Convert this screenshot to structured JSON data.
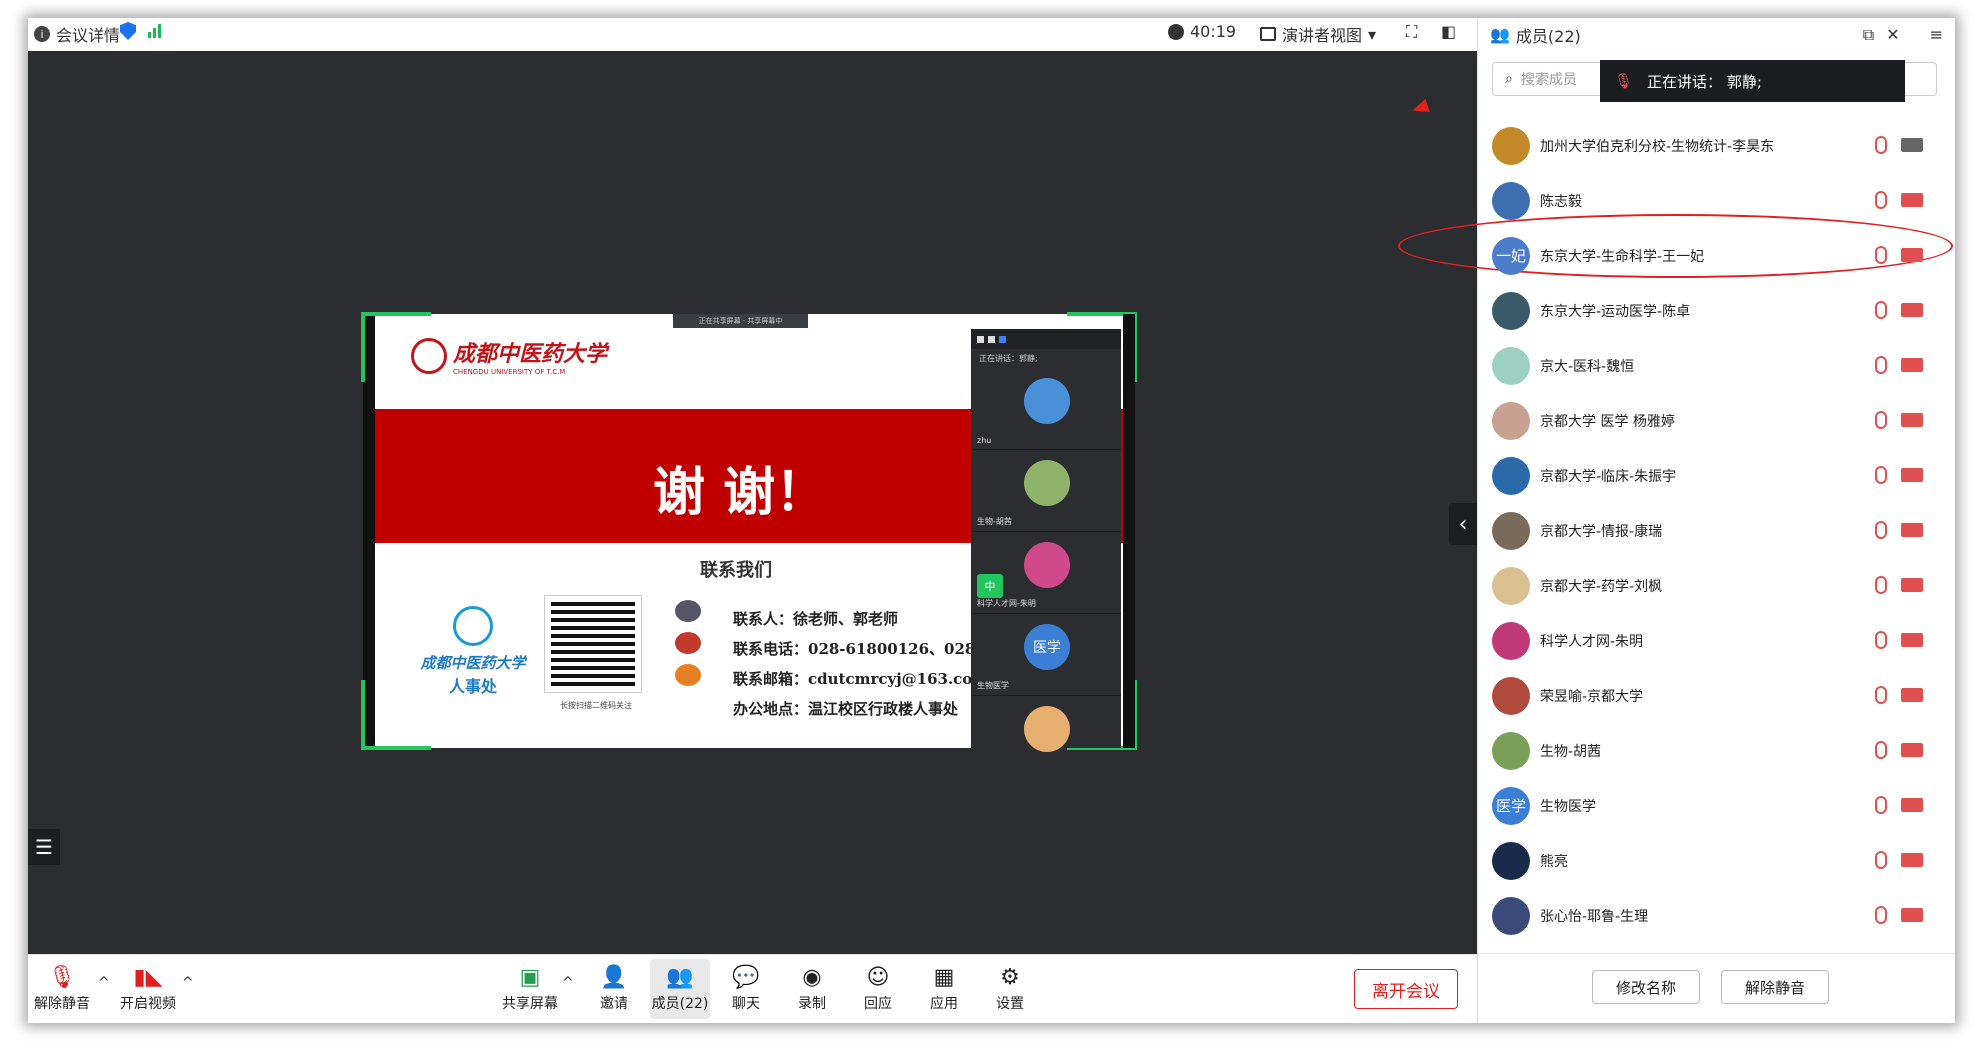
{
  "topbar": {
    "meeting_info": "会议详情",
    "timer": "40:19",
    "view_mode": "演讲者视图",
    "members_title": "成员(22)"
  },
  "shared_screen": {
    "school_name": "成都中医药大学",
    "school_en": "CHENGDU UNIVERSITY OF T.C.M",
    "thanks": "谢 谢！",
    "contact_title": "联系我们",
    "hr_name": "成都中医药大学",
    "hr_dept": "人事处",
    "qr_note": "长按扫描二维码关注",
    "contact_lines": [
      "联系人：徐老师、郭老师",
      "联系电话：028-61800126、028-61",
      "联系邮箱：cdutcmrcyj@163.com",
      "办公地点：温江校区行政楼人事处"
    ],
    "share_topbar": "正在共享屏幕 · 共享屏幕中",
    "green_tag": "中",
    "mini_speaking": "正在讲话：郭静;",
    "mini_tiles": [
      {
        "name": "zhu",
        "color": "#4a90d9"
      },
      {
        "name": "生物-胡茜",
        "color": "#8fb36a"
      },
      {
        "name": "科学人才网-朱明",
        "color": "#d04a8a"
      },
      {
        "name": "生物医学",
        "color": "#3b7fd4",
        "label": "医学"
      },
      {
        "name": "",
        "color": "#e8b070"
      }
    ]
  },
  "toolbar": {
    "unmute": "解除静音",
    "start_video": "开启视频",
    "share_screen": "共享屏幕",
    "invite": "邀请",
    "members": "成员(22)",
    "chat": "聊天",
    "record": "录制",
    "react": "回应",
    "apps": "应用",
    "settings": "设置",
    "leave": "离开会议"
  },
  "panel": {
    "search_placeholder": "搜索成员",
    "speaking_toast": "正在讲话：  郭静;",
    "members": [
      {
        "name": "加州大学伯克利分校-生物统计-李昊东",
        "color": "#c48a2a",
        "mic_off": true,
        "cam_off": false
      },
      {
        "name": "陈志毅",
        "color": "#3d6fb0",
        "mic_off": true,
        "cam_off": true
      },
      {
        "name": "东京大学-生命科学-王一妃",
        "color": "#4b7cc9",
        "label": "一妃",
        "mic_off": true,
        "cam_off": true
      },
      {
        "name": "东京大学-运动医学-陈卓",
        "color": "#3a5a6a",
        "mic_off": true,
        "cam_off": true
      },
      {
        "name": "京大-医科-魏恒",
        "color": "#9cd0c0",
        "mic_off": true,
        "cam_off": true
      },
      {
        "name": "京都大学 医学 杨雅婷",
        "color": "#c8a090",
        "mic_off": true,
        "cam_off": true
      },
      {
        "name": "京都大学-临床-朱振宇",
        "color": "#2a6aa8",
        "mic_off": true,
        "cam_off": true
      },
      {
        "name": "京都大学-情报-康瑞",
        "color": "#7a6a5a",
        "mic_off": true,
        "cam_off": true
      },
      {
        "name": "京都大学-药学-刘枫",
        "color": "#d8c090",
        "mic_off": true,
        "cam_off": true
      },
      {
        "name": "科学人才网-朱明",
        "color": "#c03a7a",
        "mic_off": true,
        "cam_off": true
      },
      {
        "name": "荣昱喻-京都大学",
        "color": "#b04a3a",
        "mic_off": true,
        "cam_off": true
      },
      {
        "name": "生物-胡茜",
        "color": "#7aa05a",
        "mic_off": true,
        "cam_off": true
      },
      {
        "name": "生物医学",
        "color": "#3b7fd4",
        "label": "医学",
        "mic_off": true,
        "cam_off": true
      },
      {
        "name": "熊亮",
        "color": "#1a2a4a",
        "mic_off": true,
        "cam_off": true
      },
      {
        "name": "张心怡-耶鲁-生理",
        "color": "#3a4a7a",
        "mic_off": true,
        "cam_off": true
      }
    ],
    "rename": "修改名称",
    "unmute_all": "解除静音"
  }
}
